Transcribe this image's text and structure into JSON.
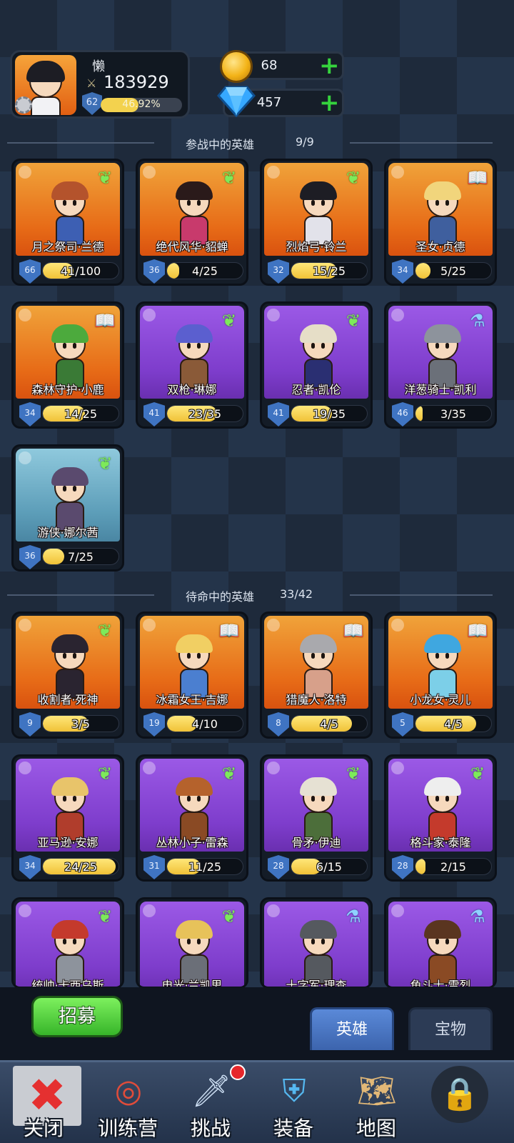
{
  "player": {
    "name": "懒",
    "power": "183929",
    "level": "62",
    "xp_percent_text": "46.92%",
    "xp_fraction": 0.4692
  },
  "currencies": {
    "gold": "68",
    "gems": "457"
  },
  "sections": {
    "active": {
      "label": "参战中的英雄",
      "count": "9/9"
    },
    "reserve": {
      "label": "待命中的英雄",
      "count": "33/42"
    }
  },
  "active_heroes": [
    {
      "name": "月之祭司·兰德",
      "level": "66",
      "progress": "41/100",
      "fill": 0.41,
      "bg": "orange",
      "class_icon": "wing-icon",
      "hair": "#b4532c",
      "outfit": "#3d5fb3"
    },
    {
      "name": "绝代风华·貂蝉",
      "level": "36",
      "progress": "4/25",
      "fill": 0.16,
      "bg": "orange",
      "class_icon": "wing-icon",
      "hair": "#2a1a1a",
      "outfit": "#c83a6c"
    },
    {
      "name": "烈焰弓·铃兰",
      "level": "32",
      "progress": "15/25",
      "fill": 0.6,
      "bg": "orange",
      "class_icon": "wing-icon",
      "hair": "#1d1d24",
      "outfit": "#e2e2ea"
    },
    {
      "name": "圣女·贞德",
      "level": "34",
      "progress": "5/25",
      "fill": 0.2,
      "bg": "orange",
      "class_icon": "book-icon",
      "hair": "#f1d57c",
      "outfit": "#3f5f9e"
    },
    {
      "name": "森林守护·小鹿",
      "level": "34",
      "progress": "14/25",
      "fill": 0.56,
      "bg": "orange",
      "class_icon": "book-icon",
      "hair": "#4caa3d",
      "outfit": "#3a7a36"
    },
    {
      "name": "双枪·琳娜",
      "level": "41",
      "progress": "23/35",
      "fill": 0.66,
      "bg": "purple",
      "class_icon": "wing-icon",
      "hair": "#5b5fcf",
      "outfit": "#8a5a38"
    },
    {
      "name": "忍者·凯伦",
      "level": "41",
      "progress": "19/35",
      "fill": 0.54,
      "bg": "purple",
      "class_icon": "wing-icon",
      "hair": "#e6dec7",
      "outfit": "#2a2f72"
    },
    {
      "name": "洋葱骑士·凯利",
      "level": "46",
      "progress": "3/35",
      "fill": 0.09,
      "bg": "purple",
      "class_icon": "potion-icon",
      "hair": "#8d939c",
      "outfit": "#6b7079"
    },
    {
      "name": "游侠·娜尔茜",
      "level": "36",
      "progress": "7/25",
      "fill": 0.28,
      "bg": "blue",
      "class_icon": "wing-icon",
      "hair": "#5a4a6e",
      "outfit": "#5a4a6e"
    }
  ],
  "reserve_heroes": [
    {
      "name": "收割者·死神",
      "level": "9",
      "progress": "3/5",
      "fill": 0.6,
      "bg": "orange",
      "class_icon": "wing-icon",
      "hair": "#2a2430",
      "outfit": "#2a2430"
    },
    {
      "name": "冰霜女王·吉娜",
      "level": "19",
      "progress": "4/10",
      "fill": 0.4,
      "bg": "orange",
      "class_icon": "book-icon",
      "hair": "#f1cf63",
      "outfit": "#4b7fd0"
    },
    {
      "name": "猎魔人·洛特",
      "level": "8",
      "progress": "4/5",
      "fill": 0.8,
      "bg": "orange",
      "class_icon": "book-icon",
      "hair": "#a9a9ad",
      "outfit": "#d7a08a"
    },
    {
      "name": "小龙女·灵儿",
      "level": "5",
      "progress": "4/5",
      "fill": 0.8,
      "bg": "orange",
      "class_icon": "book-icon",
      "hair": "#3fa7e0",
      "outfit": "#7ccfe8"
    },
    {
      "name": "亚马逊·安娜",
      "level": "34",
      "progress": "24/25",
      "fill": 0.96,
      "bg": "purple",
      "class_icon": "wing-icon",
      "hair": "#e8c46a",
      "outfit": "#b03d2c"
    },
    {
      "name": "丛林小子·雷森",
      "level": "31",
      "progress": "11/25",
      "fill": 0.44,
      "bg": "purple",
      "class_icon": "wing-icon",
      "hair": "#b5622c",
      "outfit": "#8a4a24"
    },
    {
      "name": "骨矛·伊迪",
      "level": "28",
      "progress": "6/15",
      "fill": 0.4,
      "bg": "purple",
      "class_icon": "wing-icon",
      "hair": "#e6e1d3",
      "outfit": "#4c6e3a"
    },
    {
      "name": "格斗家·泰隆",
      "level": "28",
      "progress": "2/15",
      "fill": 0.13,
      "bg": "purple",
      "class_icon": "wing-icon",
      "hair": "#eeeeee",
      "outfit": "#c43a2c"
    },
    {
      "name": "统帅·卡西乌斯",
      "level": "",
      "progress": "",
      "fill": 0,
      "bg": "purple",
      "class_icon": "wing-icon",
      "hair": "#c43a2c",
      "outfit": "#8d939c"
    },
    {
      "name": "电光·兰凯思",
      "level": "",
      "progress": "",
      "fill": 0,
      "bg": "purple",
      "class_icon": "wing-icon",
      "hair": "#e7c25a",
      "outfit": "#6b6f78"
    },
    {
      "name": "十字军·理查",
      "level": "",
      "progress": "",
      "fill": 0,
      "bg": "purple",
      "class_icon": "potion-icon",
      "hair": "#55595f",
      "outfit": "#55595f"
    },
    {
      "name": "角斗士·雷烈",
      "level": "",
      "progress": "",
      "fill": 0,
      "bg": "purple",
      "class_icon": "potion-icon",
      "hair": "#5a3520",
      "outfit": "#8a4a24"
    }
  ],
  "controls": {
    "recruit": "招募",
    "tab_heroes": "英雄",
    "tab_treasure": "宝物"
  },
  "nav": [
    {
      "label": "关闭",
      "icon": "close-icon"
    },
    {
      "label": "训练营",
      "icon": "target-icon"
    },
    {
      "label": "挑战",
      "icon": "sword-icon"
    },
    {
      "label": "装备",
      "icon": "armor-icon"
    },
    {
      "label": "地图",
      "icon": "map-icon"
    },
    {
      "label": "",
      "icon": "lock-icon"
    }
  ],
  "colors": {
    "accent_green": "#35d33d",
    "xp_yellow": "#f3d24e",
    "level_blue": "#3f74c2"
  }
}
